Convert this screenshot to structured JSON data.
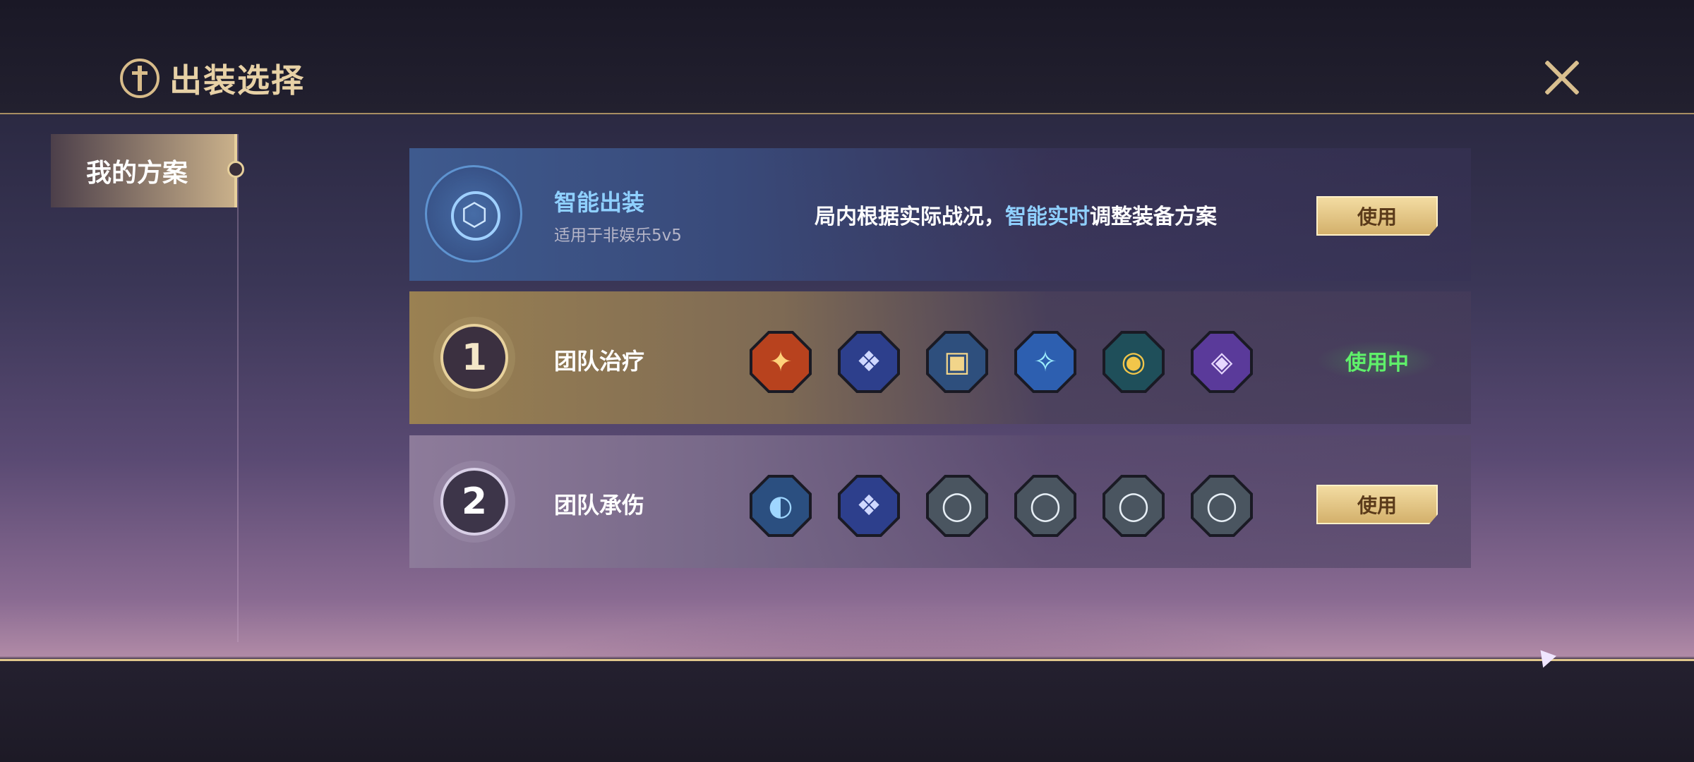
{
  "header": {
    "title": "出装选择"
  },
  "sidebar": {
    "items": [
      {
        "label": "我的方案",
        "selected": true
      }
    ]
  },
  "smart_build": {
    "title": "智能出装",
    "subtitle": "适用于非娱乐5v5",
    "description_prefix": "局内根据实际战况，",
    "description_highlight": "智能实时",
    "description_suffix": "调整装备方案",
    "button_label": "使用"
  },
  "plans": [
    {
      "number": "1",
      "name": "团队治疗",
      "status_label": "使用中",
      "in_use": true,
      "items": [
        {
          "icon": "flame-crest-icon",
          "color": "#b8421e",
          "glyph": "✦"
        },
        {
          "icon": "blue-wing-helm-icon",
          "color": "#2d3f8c",
          "glyph": "❖"
        },
        {
          "icon": "spell-book-icon",
          "color": "#2e4f7d",
          "glyph": "▣"
        },
        {
          "icon": "crystal-scepter-icon",
          "color": "#2d5fb0",
          "glyph": "✧"
        },
        {
          "icon": "golden-orb-icon",
          "color": "#1f4f5a",
          "glyph": "◉"
        },
        {
          "icon": "purple-rune-stone-icon",
          "color": "#5a3a9a",
          "glyph": "◈"
        }
      ]
    },
    {
      "number": "2",
      "name": "团队承伤",
      "button_label": "使用",
      "in_use": false,
      "items": [
        {
          "icon": "eagle-eye-icon",
          "color": "#2b4f80",
          "glyph": "◐"
        },
        {
          "icon": "blue-wing-helm-icon",
          "color": "#2d3f8c",
          "glyph": "❖"
        },
        {
          "icon": "silver-ring-icon",
          "color": "#4a5560",
          "glyph": "◯"
        },
        {
          "icon": "silver-ring-icon",
          "color": "#4a5560",
          "glyph": "◯"
        },
        {
          "icon": "silver-ring-icon",
          "color": "#4a5560",
          "glyph": "◯"
        },
        {
          "icon": "silver-ring-icon",
          "color": "#4a5560",
          "glyph": "◯"
        }
      ]
    }
  ],
  "colors": {
    "accent_gold": "#e7d1a6",
    "accent_blue": "#8fd0ff",
    "in_use_green": "#5ff06a"
  }
}
